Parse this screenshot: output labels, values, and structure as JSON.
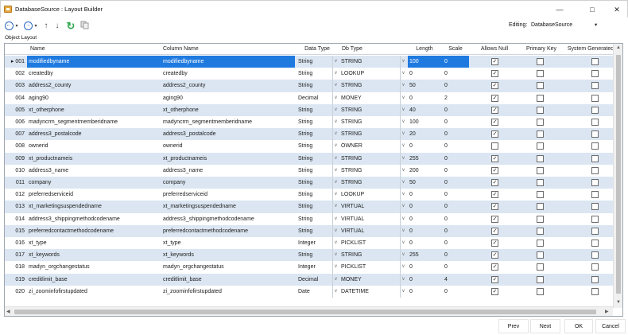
{
  "window": {
    "title": "DatabaseSource : Layout Builder",
    "minimize_glyph": "—",
    "maximize_glyph": "□",
    "close_glyph": "✕"
  },
  "toolbar": {
    "back_glyph": "←",
    "forward_glyph": "→",
    "up_glyph": "↑",
    "down_glyph": "↓",
    "refresh_glyph": "↻",
    "editing_label": "Editing:",
    "editing_value": "DatabaseSource"
  },
  "section_label": "Object Layout",
  "grid": {
    "columns": [
      "Name",
      "Column Name",
      "Data Type",
      "Db Type",
      "Length",
      "Scale",
      "Allows Null",
      "Primary Key",
      "System Generated"
    ],
    "rows": [
      {
        "num": "001",
        "name": "modifiedbyname",
        "col": "modifiedbyname",
        "dtype": "String",
        "dbtype": "STRING",
        "len": "100",
        "scale": "0",
        "null": true,
        "pk": false,
        "sg": false
      },
      {
        "num": "002",
        "name": "createdby",
        "col": "createdby",
        "dtype": "String",
        "dbtype": "LOOKUP",
        "len": "0",
        "scale": "0",
        "null": true,
        "pk": false,
        "sg": false
      },
      {
        "num": "003",
        "name": "address2_county",
        "col": "address2_county",
        "dtype": "String",
        "dbtype": "STRING",
        "len": "50",
        "scale": "0",
        "null": true,
        "pk": false,
        "sg": false
      },
      {
        "num": "004",
        "name": "aging90",
        "col": "aging90",
        "dtype": "Decimal",
        "dbtype": "MONEY",
        "len": "0",
        "scale": "2",
        "null": true,
        "pk": false,
        "sg": false
      },
      {
        "num": "005",
        "name": "xt_otherphone",
        "col": "xt_otherphone",
        "dtype": "String",
        "dbtype": "STRING",
        "len": "40",
        "scale": "0",
        "null": true,
        "pk": false,
        "sg": false
      },
      {
        "num": "006",
        "name": "madyncrm_segmentmemberidname",
        "col": "madyncrm_segmentmemberidname",
        "dtype": "String",
        "dbtype": "STRING",
        "len": "100",
        "scale": "0",
        "null": true,
        "pk": false,
        "sg": false
      },
      {
        "num": "007",
        "name": "address3_postalcode",
        "col": "address3_postalcode",
        "dtype": "String",
        "dbtype": "STRING",
        "len": "20",
        "scale": "0",
        "null": true,
        "pk": false,
        "sg": false
      },
      {
        "num": "008",
        "name": "ownerid",
        "col": "ownerid",
        "dtype": "String",
        "dbtype": "OWNER",
        "len": "0",
        "scale": "0",
        "null": false,
        "pk": false,
        "sg": false
      },
      {
        "num": "009",
        "name": "xt_productnameis",
        "col": "xt_productnameis",
        "dtype": "String",
        "dbtype": "STRING",
        "len": "255",
        "scale": "0",
        "null": true,
        "pk": false,
        "sg": false
      },
      {
        "num": "010",
        "name": "address3_name",
        "col": "address3_name",
        "dtype": "String",
        "dbtype": "STRING",
        "len": "200",
        "scale": "0",
        "null": true,
        "pk": false,
        "sg": false
      },
      {
        "num": "011",
        "name": "company",
        "col": "company",
        "dtype": "String",
        "dbtype": "STRING",
        "len": "50",
        "scale": "0",
        "null": true,
        "pk": false,
        "sg": false
      },
      {
        "num": "012",
        "name": "preferredserviceid",
        "col": "preferredserviceid",
        "dtype": "String",
        "dbtype": "LOOKUP",
        "len": "0",
        "scale": "0",
        "null": true,
        "pk": false,
        "sg": false
      },
      {
        "num": "013",
        "name": "xt_marketingsuspendedname",
        "col": "xt_marketingsuspendedname",
        "dtype": "String",
        "dbtype": "VIRTUAL",
        "len": "0",
        "scale": "0",
        "null": true,
        "pk": false,
        "sg": false
      },
      {
        "num": "014",
        "name": "address3_shippingmethodcodename",
        "col": "address3_shippingmethodcodename",
        "dtype": "String",
        "dbtype": "VIRTUAL",
        "len": "0",
        "scale": "0",
        "null": true,
        "pk": false,
        "sg": false
      },
      {
        "num": "015",
        "name": "preferredcontactmethodcodename",
        "col": "preferredcontactmethodcodename",
        "dtype": "String",
        "dbtype": "VIRTUAL",
        "len": "0",
        "scale": "0",
        "null": true,
        "pk": false,
        "sg": false
      },
      {
        "num": "016",
        "name": "xt_type",
        "col": "xt_type",
        "dtype": "Integer",
        "dbtype": "PICKLIST",
        "len": "0",
        "scale": "0",
        "null": true,
        "pk": false,
        "sg": false
      },
      {
        "num": "017",
        "name": "xt_keywords",
        "col": "xt_keywords",
        "dtype": "String",
        "dbtype": "STRING",
        "len": "255",
        "scale": "0",
        "null": true,
        "pk": false,
        "sg": false
      },
      {
        "num": "018",
        "name": "madyn_orgchangestatus",
        "col": "madyn_orgchangestatus",
        "dtype": "Integer",
        "dbtype": "PICKLIST",
        "len": "0",
        "scale": "0",
        "null": true,
        "pk": false,
        "sg": false
      },
      {
        "num": "019",
        "name": "creditlimit_base",
        "col": "creditlimit_base",
        "dtype": "Decimal",
        "dbtype": "MONEY",
        "len": "0",
        "scale": "4",
        "null": true,
        "pk": false,
        "sg": false
      },
      {
        "num": "020",
        "name": "zi_zoominfofirstupdated",
        "col": "zi_zoominfofirstupdated",
        "dtype": "Date",
        "dbtype": "DATETIME",
        "len": "0",
        "scale": "0",
        "null": true,
        "pk": false,
        "sg": false
      }
    ],
    "selected_row": 0
  },
  "footer": {
    "prev": "Prev",
    "next": "Next",
    "ok": "OK",
    "cancel": "Cancel"
  },
  "colors": {
    "selection": "#1f7ae0",
    "alt_row": "#dbe6f2",
    "toolbar_icon": "#2b66c2",
    "refresh_icon": "#2fa84f"
  }
}
